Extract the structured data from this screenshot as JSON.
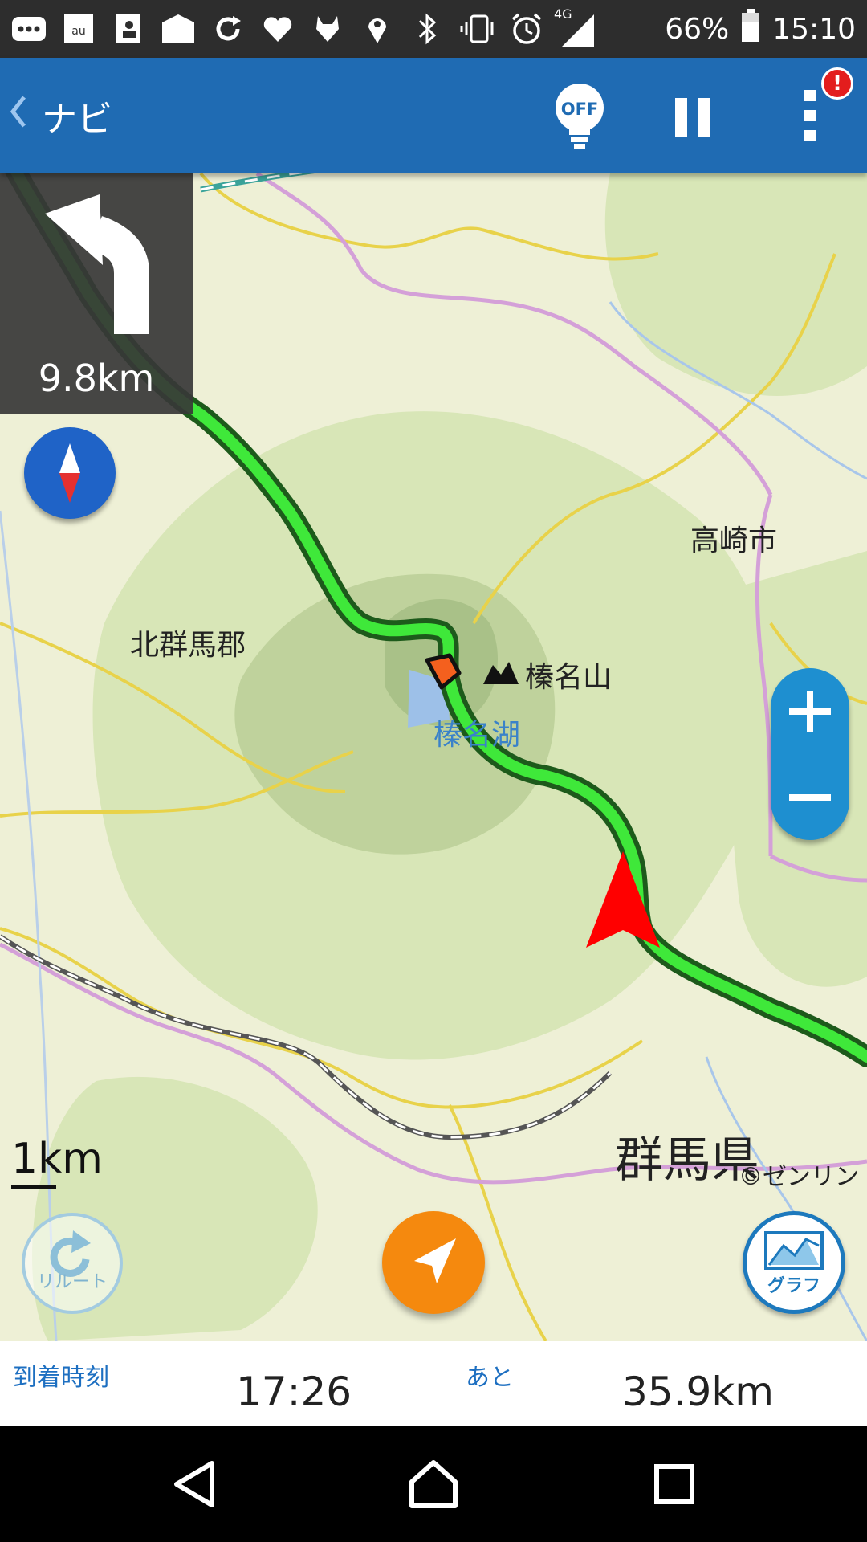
{
  "status_bar": {
    "network": "4G",
    "battery": "66%",
    "time": "15:10"
  },
  "toolbar": {
    "back_label": "ナビ",
    "light_label": "OFF",
    "alert_badge": "!"
  },
  "map": {
    "labels": {
      "takasaki": "高崎市",
      "kitagunma": "北群馬郡",
      "harunasan": "榛名山",
      "harunako": "榛名湖",
      "gunma": "群馬県"
    },
    "scale": "1km",
    "copyright": "©ゼンリン"
  },
  "turn_instruction": {
    "distance": "9.8km"
  },
  "buttons": {
    "reroute_label": "リルート",
    "graph_label": "グラフ"
  },
  "info_bar": {
    "arrival_label": "到着時刻",
    "arrival_time": "17:26",
    "remaining_label": "あと",
    "remaining_distance": "35.9km"
  },
  "colors": {
    "toolbar": "#1f6bb3",
    "route": "#3fe83a",
    "route_outline": "#1d5a1b",
    "vehicle_arrow": "#ff0000",
    "locate_button": "#f5890e"
  }
}
